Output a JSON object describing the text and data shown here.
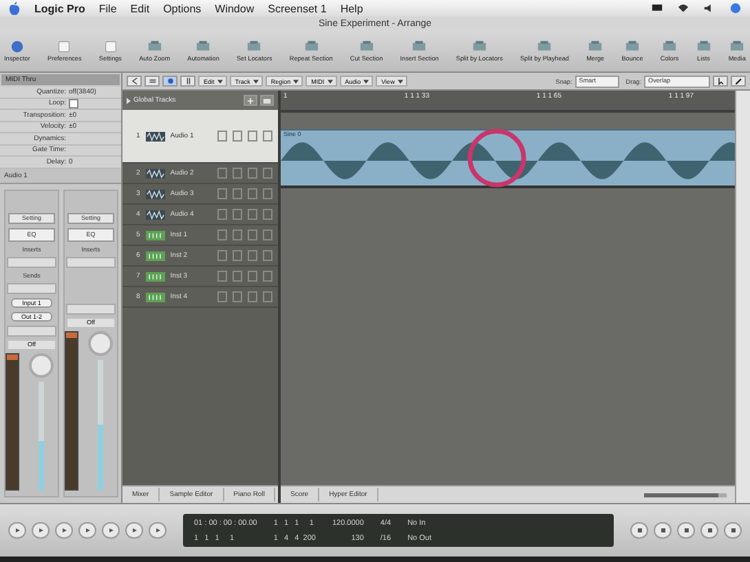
{
  "menu_bar": {
    "app": "Logic Pro",
    "items": [
      "File",
      "Edit",
      "Options",
      "Window",
      "Screenset 1",
      "Help"
    ]
  },
  "window": {
    "title": "Sine Experiment - Arrange"
  },
  "toolbar": [
    {
      "label": "Inspector",
      "kind": "info"
    },
    {
      "label": "Preferences",
      "kind": "box"
    },
    {
      "label": "Settings",
      "kind": "box"
    },
    {
      "label": "Auto Zoom",
      "kind": "tool"
    },
    {
      "label": "Automation",
      "kind": "tool"
    },
    {
      "label": "Set Locators",
      "kind": "tool"
    },
    {
      "label": "Repeat Section",
      "kind": "tool"
    },
    {
      "label": "Cut Section",
      "kind": "tool"
    },
    {
      "label": "Insert Section",
      "kind": "tool"
    },
    {
      "label": "Split by Locators",
      "kind": "tool"
    },
    {
      "label": "Split by Playhead",
      "kind": "tool"
    },
    {
      "label": "Merge",
      "kind": "tool"
    },
    {
      "label": "Bounce",
      "kind": "tool"
    },
    {
      "label": "Colors",
      "kind": "tool"
    },
    {
      "label": "Lists",
      "kind": "tool"
    },
    {
      "label": "Media",
      "kind": "tool"
    }
  ],
  "inspector": {
    "header": "MIDI Thru",
    "params": [
      {
        "label": "Quantize:",
        "value": "off(3840)"
      },
      {
        "label": "Loop:",
        "kind": "check",
        "checked": false
      },
      {
        "label": "Transposition:",
        "value": "±0"
      },
      {
        "label": "Velocity:",
        "value": "±0"
      },
      {
        "label": "Dynamics:"
      },
      {
        "label": "Gate Time:"
      },
      {
        "label": "Delay:",
        "value": "0"
      }
    ],
    "track_header": "Audio 1",
    "strips": [
      {
        "setting": "Setting",
        "eq": "EQ",
        "inserts": "Inserts",
        "sends": "Sends",
        "input": "Input 1",
        "output": "Out 1-2",
        "mode": "Off",
        "level": 0.45
      },
      {
        "setting": "Setting",
        "eq": "EQ",
        "inserts": "Inserts",
        "mode": "Off",
        "level": 0.5
      }
    ]
  },
  "edit_bar": {
    "menus": [
      "Edit",
      "Track",
      "Region",
      "MIDI",
      "Audio",
      "View"
    ],
    "snap_label": "Snap:",
    "snap": "Smart",
    "drag_label": "Drag:",
    "drag": "Overlap"
  },
  "global_tracks": "Global Tracks",
  "tracks": [
    {
      "number": "1",
      "name": "Audio 1",
      "kind": "audio",
      "selected": true
    },
    {
      "number": "2",
      "name": "Audio 2",
      "kind": "audio",
      "selected": false
    },
    {
      "number": "3",
      "name": "Audio 3",
      "kind": "audio",
      "selected": false
    },
    {
      "number": "4",
      "name": "Audio 4",
      "kind": "audio",
      "selected": false
    },
    {
      "number": "5",
      "name": "Inst 1",
      "kind": "inst",
      "selected": false
    },
    {
      "number": "6",
      "name": "Inst 2",
      "kind": "inst",
      "selected": false
    },
    {
      "number": "7",
      "name": "Inst 3",
      "kind": "inst",
      "selected": false
    },
    {
      "number": "8",
      "name": "Inst 4",
      "kind": "inst",
      "selected": false
    }
  ],
  "ruler": [
    "1",
    "1 1 1 33",
    "1 1 1 65",
    "1 1 1 97"
  ],
  "region": {
    "name": "Sine 0"
  },
  "editor_tabs": [
    "Mixer",
    "Sample Editor",
    "Piano Roll",
    "Score",
    "Hyper Editor"
  ],
  "zoom": {
    "level": 0.9
  },
  "transport": {
    "smpte": "01 : 00 : 00 : 00.00",
    "bars": "1   1   1     1",
    "pos1": "1   1   1     1",
    "pos2": "1   4   4  200",
    "tempo": "120.0000",
    "tempo2": "130",
    "sig": "4/4",
    "div": "/16",
    "in": "No In",
    "out": "No Out"
  }
}
